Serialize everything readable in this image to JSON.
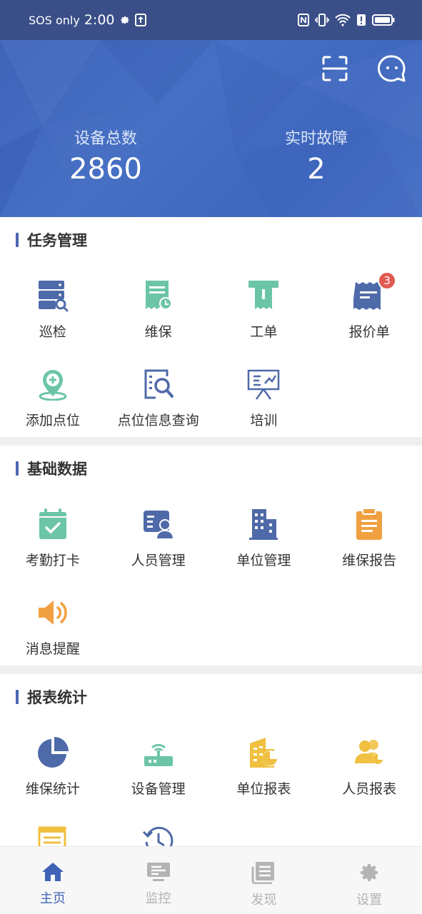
{
  "status_bar": {
    "carrier": "SOS only",
    "time": "2:00"
  },
  "header": {
    "stats": [
      {
        "label": "设备总数",
        "value": "2860"
      },
      {
        "label": "实时故障",
        "value": "2"
      }
    ],
    "icons": [
      "scan-icon",
      "message-icon"
    ]
  },
  "sections": [
    {
      "title": "任务管理",
      "items": [
        {
          "label": "巡检",
          "icon": "server-search-icon",
          "color": "#4f6aa8"
        },
        {
          "label": "维保",
          "icon": "receipt-clock-icon",
          "color": "#6cc5a8"
        },
        {
          "label": "工单",
          "icon": "ticket-icon",
          "color": "#6cc5a8"
        },
        {
          "label": "报价单",
          "icon": "invoice-icon",
          "color": "#4f6aa8",
          "badge": "3"
        },
        {
          "label": "添加点位",
          "icon": "location-add-icon",
          "color": "#6cc5a8"
        },
        {
          "label": "点位信息查询",
          "icon": "doc-search-icon",
          "color": "#4f6aa8"
        },
        {
          "label": "培训",
          "icon": "presentation-icon",
          "color": "#4f6aa8"
        }
      ]
    },
    {
      "title": "基础数据",
      "items": [
        {
          "label": "考勤打卡",
          "icon": "calendar-check-icon",
          "color": "#6cc5a8"
        },
        {
          "label": "人员管理",
          "icon": "person-card-icon",
          "color": "#4f6aa8"
        },
        {
          "label": "单位管理",
          "icon": "building-icon",
          "color": "#4f6aa8"
        },
        {
          "label": "维保报告",
          "icon": "clipboard-icon",
          "color": "#f0a040"
        },
        {
          "label": "消息提醒",
          "icon": "speaker-icon",
          "color": "#f0a040"
        }
      ]
    },
    {
      "title": "报表统计",
      "items": [
        {
          "label": "维保统计",
          "icon": "pie-chart-icon",
          "color": "#4f6aa8"
        },
        {
          "label": "设备管理",
          "icon": "router-icon",
          "color": "#6cc5a8"
        },
        {
          "label": "单位报表",
          "icon": "building-chart-icon",
          "color": "#f0c040"
        },
        {
          "label": "人员报表",
          "icon": "people-chart-icon",
          "color": "#f0c040"
        },
        {
          "label": "",
          "icon": "report-list-icon",
          "color": "#f0c040"
        },
        {
          "label": "",
          "icon": "history-clock-icon",
          "color": "#4f6aa8"
        }
      ]
    }
  ],
  "tabbar": [
    {
      "label": "主页",
      "icon": "home-icon",
      "active": true
    },
    {
      "label": "监控",
      "icon": "monitor-icon",
      "active": false
    },
    {
      "label": "发现",
      "icon": "news-icon",
      "active": false
    },
    {
      "label": "设置",
      "icon": "gear-icon",
      "active": false
    }
  ],
  "colors": {
    "primary": "#3f62b6",
    "teal": "#6cc5a8",
    "orange": "#f0a040",
    "yellow": "#f0c040",
    "badge": "#e05a52"
  }
}
